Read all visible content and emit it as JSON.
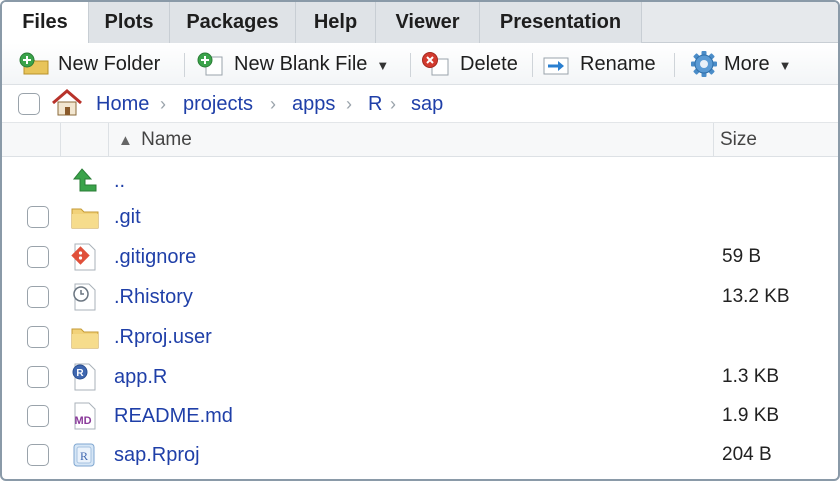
{
  "tabs": [
    {
      "label": "Files",
      "active": true
    },
    {
      "label": "Plots"
    },
    {
      "label": "Packages"
    },
    {
      "label": "Help"
    },
    {
      "label": "Viewer"
    },
    {
      "label": "Presentation"
    }
  ],
  "toolbar": {
    "new_folder": "New Folder",
    "new_blank_file": "New Blank File",
    "delete": "Delete",
    "rename": "Rename",
    "more": "More"
  },
  "breadcrumb": [
    "Home",
    "projects",
    "apps",
    "R",
    "sap"
  ],
  "table": {
    "col_name": "Name",
    "col_size": "Size",
    "sort": "ascending"
  },
  "files": [
    {
      "name": "..",
      "size": "",
      "icon": "parent-directory-icon"
    },
    {
      "name": ".git",
      "size": "",
      "icon": "folder-icon"
    },
    {
      "name": ".gitignore",
      "size": "59 B",
      "icon": "git-file-icon"
    },
    {
      "name": ".Rhistory",
      "size": "13.2 KB",
      "icon": "history-file-icon"
    },
    {
      "name": ".Rproj.user",
      "size": "",
      "icon": "folder-icon"
    },
    {
      "name": "app.R",
      "size": "1.3 KB",
      "icon": "r-script-icon"
    },
    {
      "name": "README.md",
      "size": "1.9 KB",
      "icon": "markdown-file-icon"
    },
    {
      "name": "sap.Rproj",
      "size": "204 B",
      "icon": "rproject-file-icon"
    }
  ],
  "colors": {
    "link": "#1f3fa8",
    "tab_bg": "#e6e9ec",
    "pane_border": "#8a9aa8"
  }
}
